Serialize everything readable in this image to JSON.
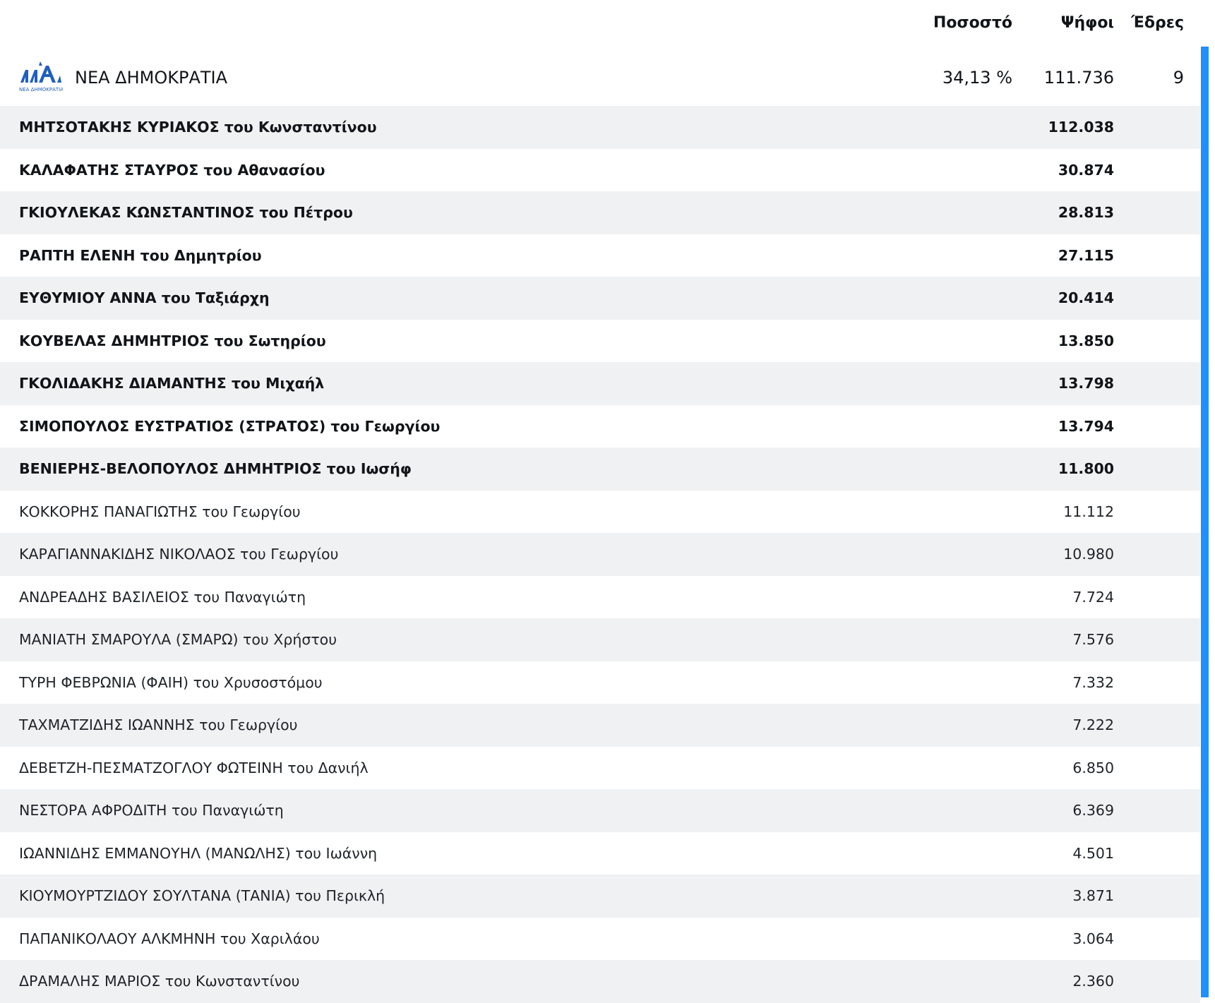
{
  "columns": {
    "percent": "Ποσοστό",
    "votes": "Ψήφοι",
    "seats": "Έδρες"
  },
  "party": {
    "logo_text": "ΝΕΑ ΔΗΜΟΚΡΑΤΙΑ",
    "logo_icon": "nd-logo-icon",
    "name": "ΝΕΑ ΔΗΜΟΚΡΑΤΙΑ",
    "percent": "34,13 %",
    "votes": "111.736",
    "seats": "9"
  },
  "colors": {
    "accent": "#1e90ff",
    "row_alt": "#f0f1f3",
    "logo_blue": "#1f5fbf"
  },
  "candidates": [
    {
      "name": "ΜΗΤΣΟΤΑΚΗΣ ΚΥΡΙΑΚΟΣ του Κωνσταντίνου",
      "votes": "112.038",
      "elected": true
    },
    {
      "name": "ΚΑΛΑΦΑΤΗΣ ΣΤΑΥΡΟΣ του Αθανασίου",
      "votes": "30.874",
      "elected": true
    },
    {
      "name": "ΓΚΙΟΥΛΕΚΑΣ ΚΩΝΣΤΑΝΤΙΝΟΣ του Πέτρου",
      "votes": "28.813",
      "elected": true
    },
    {
      "name": "ΡΑΠΤΗ ΕΛΕΝΗ του Δημητρίου",
      "votes": "27.115",
      "elected": true
    },
    {
      "name": "ΕΥΘΥΜΙΟΥ ΑΝΝΑ του Ταξιάρχη",
      "votes": "20.414",
      "elected": true
    },
    {
      "name": "ΚΟΥΒΕΛΑΣ ΔΗΜΗΤΡΙΟΣ του Σωτηρίου",
      "votes": "13.850",
      "elected": true
    },
    {
      "name": "ΓΚΟΛΙΔΑΚΗΣ ΔΙΑΜΑΝΤΗΣ του Μιχαήλ",
      "votes": "13.798",
      "elected": true
    },
    {
      "name": "ΣΙΜΟΠΟΥΛΟΣ ΕΥΣΤΡΑΤΙΟΣ (ΣΤΡΑΤΟΣ) του Γεωργίου",
      "votes": "13.794",
      "elected": true
    },
    {
      "name": "ΒΕΝΙΕΡΗΣ-ΒΕΛΟΠΟΥΛΟΣ ΔΗΜΗΤΡΙΟΣ του Ιωσήφ",
      "votes": "11.800",
      "elected": true
    },
    {
      "name": "ΚΟΚΚΟΡΗΣ ΠΑΝΑΓΙΩΤΗΣ του Γεωργίου",
      "votes": "11.112",
      "elected": false
    },
    {
      "name": "ΚΑΡΑΓΙΑΝΝΑΚΙΔΗΣ ΝΙΚΟΛΑΟΣ του Γεωργίου",
      "votes": "10.980",
      "elected": false
    },
    {
      "name": "ΑΝΔΡΕΑΔΗΣ ΒΑΣΙΛΕΙΟΣ του Παναγιώτη",
      "votes": "7.724",
      "elected": false
    },
    {
      "name": "ΜΑΝΙΑΤΗ ΣΜΑΡΟΥΛΑ (ΣΜΑΡΩ) του Χρήστου",
      "votes": "7.576",
      "elected": false
    },
    {
      "name": "ΤΥΡΗ ΦΕΒΡΩΝΙΑ (ΦΑΙΗ) του Χρυσοστόμου",
      "votes": "7.332",
      "elected": false
    },
    {
      "name": "ΤΑΧΜΑΤΖΙΔΗΣ ΙΩΑΝΝΗΣ του Γεωργίου",
      "votes": "7.222",
      "elected": false
    },
    {
      "name": "ΔΕΒΕΤΖΗ-ΠΕΣΜΑΤΖΟΓΛΟΥ ΦΩΤΕΙΝΗ του Δανιήλ",
      "votes": "6.850",
      "elected": false
    },
    {
      "name": "ΝΕΣΤΟΡΑ ΑΦΡΟΔΙΤΗ του Παναγιώτη",
      "votes": "6.369",
      "elected": false
    },
    {
      "name": "ΙΩΑΝΝΙΔΗΣ ΕΜΜΑΝΟΥΗΛ (ΜΑΝΩΛΗΣ) του Ιωάννη",
      "votes": "4.501",
      "elected": false
    },
    {
      "name": "ΚΙΟΥΜΟΥΡΤΖΙΔΟΥ ΣΟΥΛΤΑΝΑ (ΤΑΝΙΑ) του Περικλή",
      "votes": "3.871",
      "elected": false
    },
    {
      "name": "ΠΑΠΑΝΙΚΟΛΑΟΥ ΑΛΚΜΗΝΗ του Χαριλάου",
      "votes": "3.064",
      "elected": false
    },
    {
      "name": "ΔΡΑΜΑΛΗΣ ΜΑΡΙΟΣ του Κωνσταντίνου",
      "votes": "2.360",
      "elected": false
    }
  ]
}
